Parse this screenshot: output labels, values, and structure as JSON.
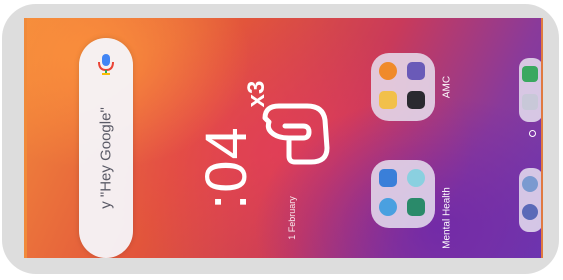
{
  "search": {
    "text": "y \"Hey Google\""
  },
  "clock": {
    "time": ":04",
    "date": "1 February"
  },
  "gesture": {
    "repeat": "x3"
  },
  "folders": [
    {
      "label": "AMC"
    },
    {
      "label": "Mental Health"
    }
  ],
  "colors": {
    "accent": "#f08a3a",
    "bezel": "#dddddd",
    "folder_bg": "#e6e1f0"
  },
  "icons": [
    "mic-icon",
    "hand-tap-icon"
  ]
}
